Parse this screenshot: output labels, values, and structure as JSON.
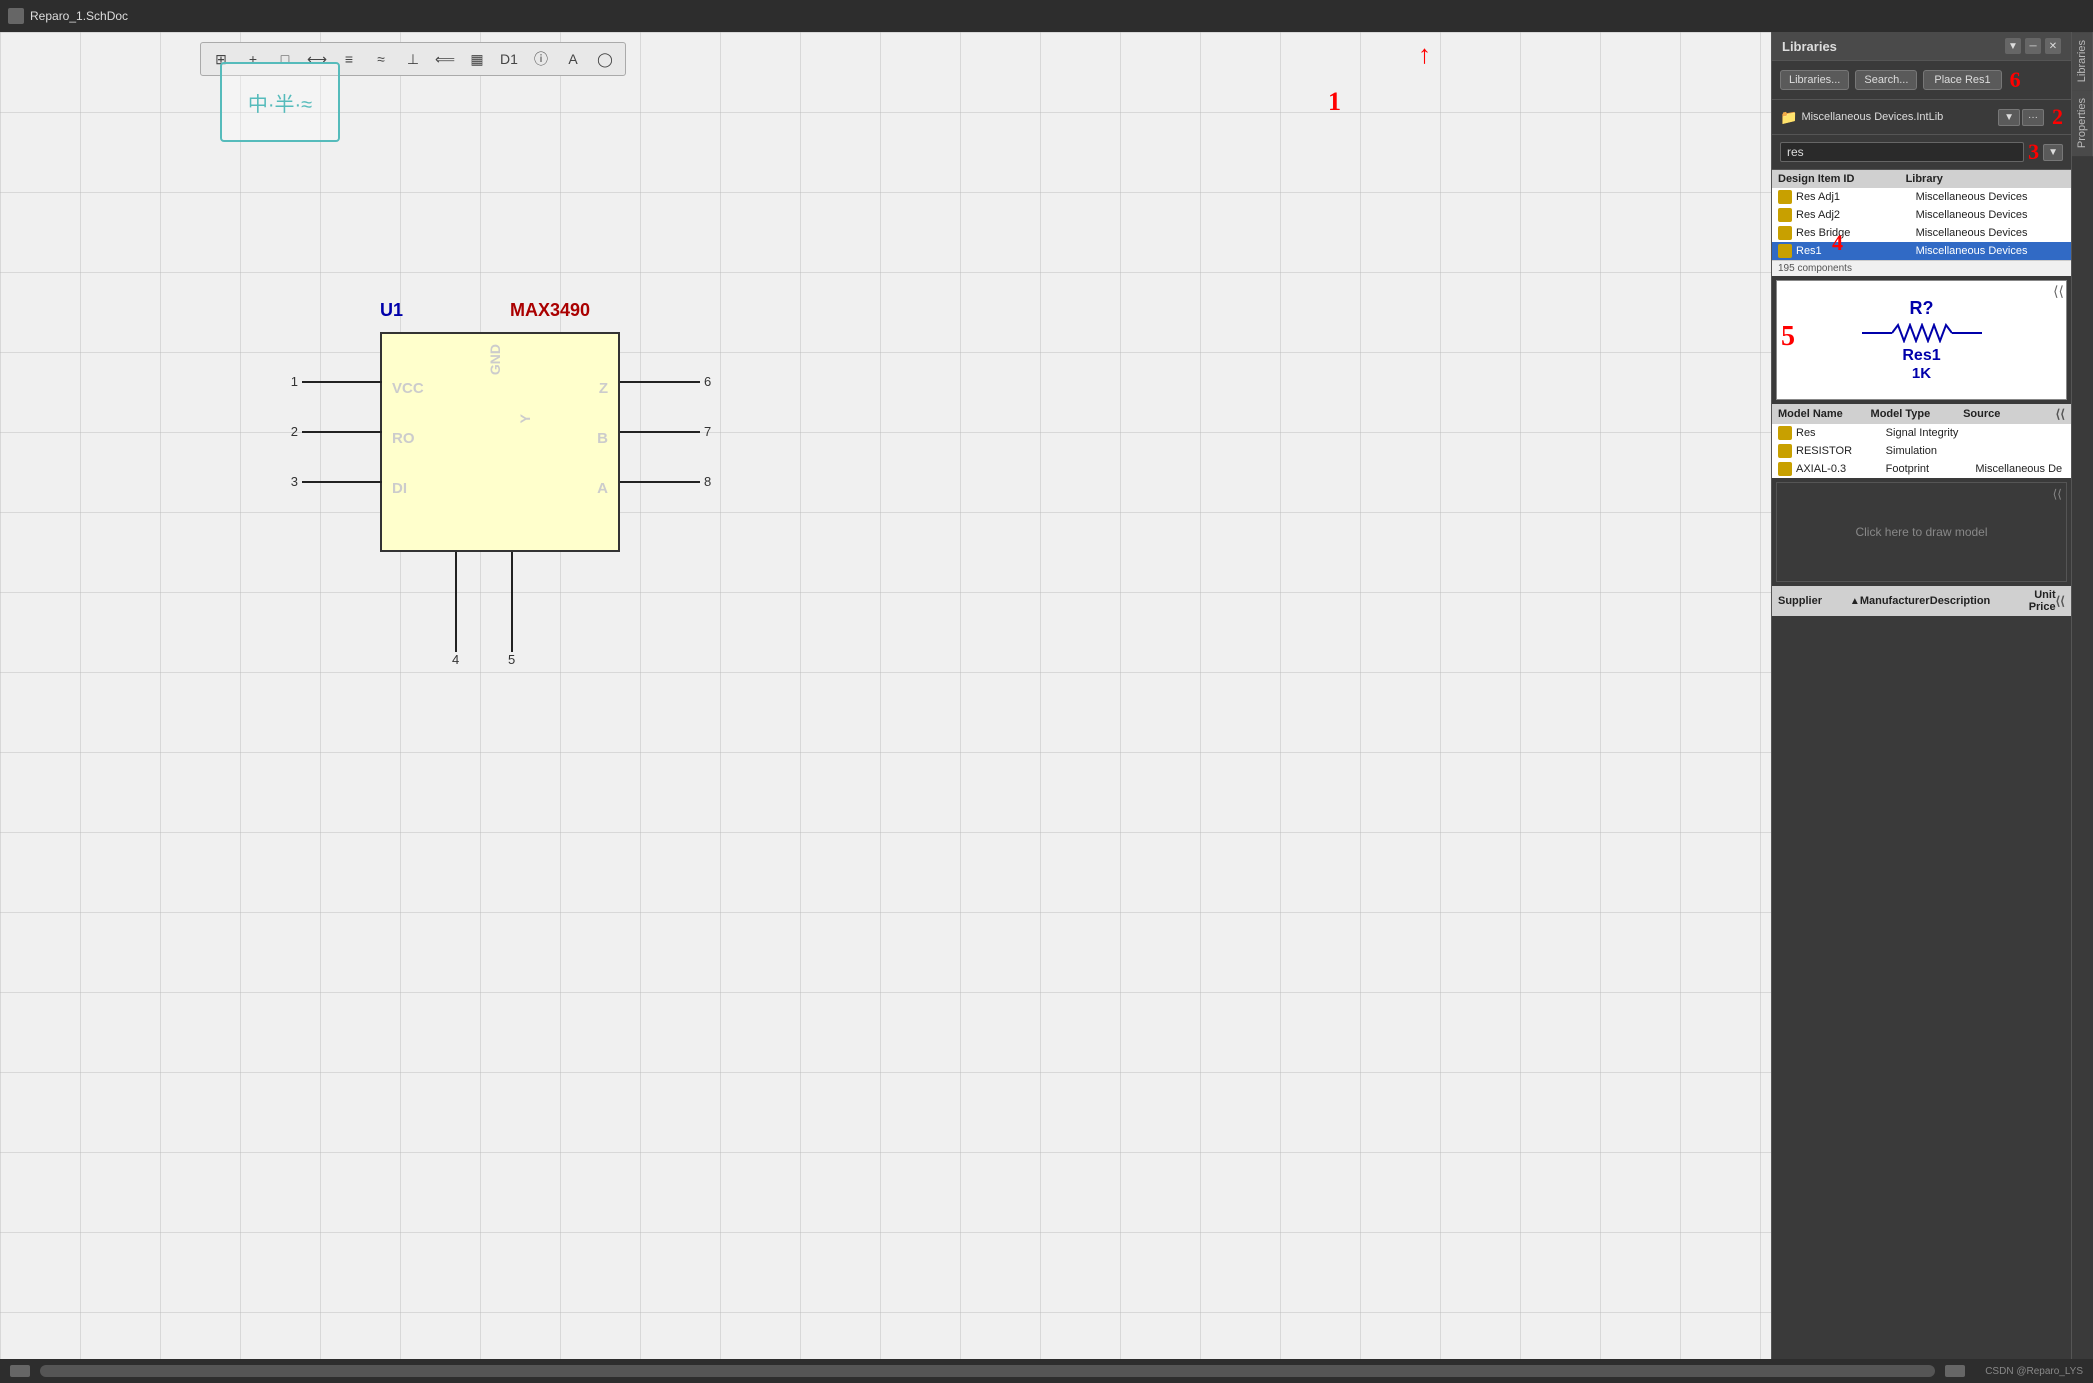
{
  "titlebar": {
    "filename": "Reparo_1.SchDoc"
  },
  "toolbar": {
    "buttons": [
      "⊞",
      "+",
      "□",
      "⟷",
      "≡",
      "≈",
      "⊥",
      "⟸",
      "▦",
      "D1",
      "ⓘ",
      "A",
      "◯"
    ]
  },
  "symbol_thumb": {
    "chars": "中·半·≈"
  },
  "ic": {
    "ref": "U1",
    "part": "MAX3490",
    "box_bg": "#ffffcc",
    "pins_left": [
      {
        "num": "1",
        "label": "VCC"
      },
      {
        "num": "2",
        "label": "RO"
      },
      {
        "num": "3",
        "label": "DI"
      }
    ],
    "pins_right": [
      {
        "num": "6",
        "label": "Z"
      },
      {
        "num": "7",
        "label": "B"
      },
      {
        "num": "8",
        "label": "A"
      }
    ],
    "pins_bottom": [
      {
        "num": "4",
        "label": ""
      },
      {
        "num": "5",
        "label": ""
      }
    ],
    "center_vertical1": "GND",
    "center_vertical2": "Y"
  },
  "annotations": {
    "num1": "1",
    "num2": "2",
    "num3": "3",
    "num4": "4",
    "num5": "5",
    "num6": "6"
  },
  "libraries_panel": {
    "title": "Libraries",
    "btn_libraries": "Libraries...",
    "btn_search": "Search...",
    "btn_place": "Place Res1",
    "selected_lib": "Miscellaneous Devices.IntLib",
    "search_value": "res",
    "columns": {
      "design_item_id": "Design Item ID",
      "library": "Library"
    },
    "components": [
      {
        "id": "Res Adj1",
        "library": "Miscellaneous Devices",
        "selected": false
      },
      {
        "id": "Res Adj2",
        "library": "Miscellaneous Devices",
        "selected": false
      },
      {
        "id": "Res Bridge",
        "library": "Miscellaneous Devices",
        "selected": false
      },
      {
        "id": "Res1",
        "library": "Miscellaneous Devices",
        "selected": true
      }
    ],
    "component_count": "195 components",
    "preview": {
      "ref": "R?",
      "name": "Res1",
      "value": "1K"
    },
    "models": {
      "header_model_name": "Model Name",
      "header_model_type": "Model Type",
      "header_source": "Source",
      "rows": [
        {
          "name": "Res",
          "type": "Signal Integrity",
          "source": ""
        },
        {
          "name": "RESISTOR",
          "type": "Simulation",
          "source": ""
        },
        {
          "name": "AXIAL-0.3",
          "type": "Footprint",
          "source": "Miscellaneous De"
        }
      ]
    },
    "draw_model_text": "Click here to draw model",
    "supplier_header": {
      "supplier": "Supplier",
      "manufacturer": "Manufacturer",
      "description": "Description",
      "unit_price": "Unit Price"
    }
  },
  "side_tabs": {
    "libraries": "Libraries",
    "properties": "Properties"
  },
  "bottom_bar": {
    "attribution": "CSDN @Reparo_LYS"
  }
}
